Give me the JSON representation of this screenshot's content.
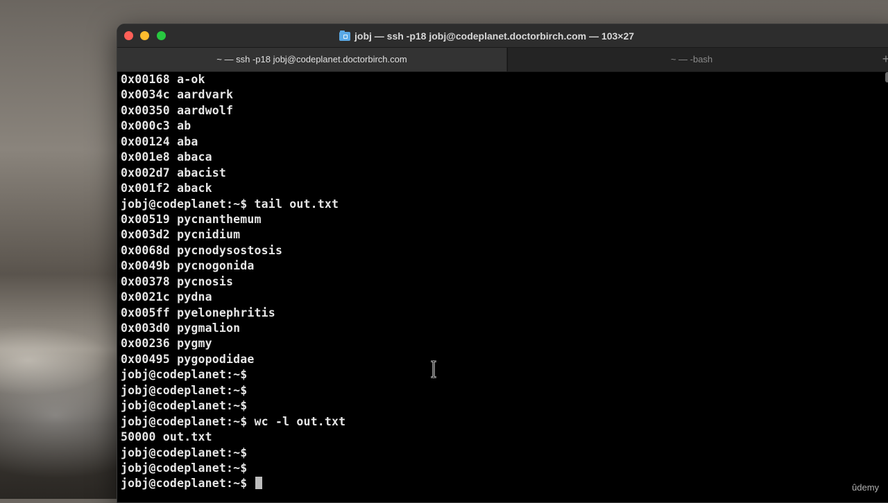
{
  "window": {
    "title": "jobj — ssh -p18 jobj@codeplanet.doctorbirch.com — 103×27"
  },
  "tabs": [
    {
      "label": "~ — ssh -p18 jobj@codeplanet.doctorbirch.com",
      "active": true
    },
    {
      "label": "~ — -bash",
      "active": false
    }
  ],
  "terminal": {
    "lines": [
      "0x00168 a-ok",
      "0x0034c aardvark",
      "0x00350 aardwolf",
      "0x000c3 ab",
      "0x00124 aba",
      "0x001e8 abaca",
      "0x002d7 abacist",
      "0x001f2 aback",
      "jobj@codeplanet:~$ tail out.txt",
      "0x00519 pycnanthemum",
      "0x003d2 pycnidium",
      "0x0068d pycnodysostosis",
      "0x0049b pycnogonida",
      "0x00378 pycnosis",
      "0x0021c pydna",
      "0x005ff pyelonephritis",
      "0x003d0 pygmalion",
      "0x00236 pygmy",
      "0x00495 pygopodidae",
      "jobj@codeplanet:~$",
      "jobj@codeplanet:~$",
      "jobj@codeplanet:~$",
      "jobj@codeplanet:~$ wc -l out.txt",
      "50000 out.txt",
      "jobj@codeplanet:~$",
      "jobj@codeplanet:~$",
      "jobj@codeplanet:~$ "
    ]
  },
  "watermark": "ûdemy",
  "colors": {
    "close": "#fe5f57",
    "minimize": "#febc2e",
    "maximize": "#28c840",
    "terminal_bg": "#000000",
    "terminal_fg": "#e6e6e6"
  },
  "icons": {
    "title_icon": "folder-icon",
    "new_tab": "plus-icon"
  }
}
